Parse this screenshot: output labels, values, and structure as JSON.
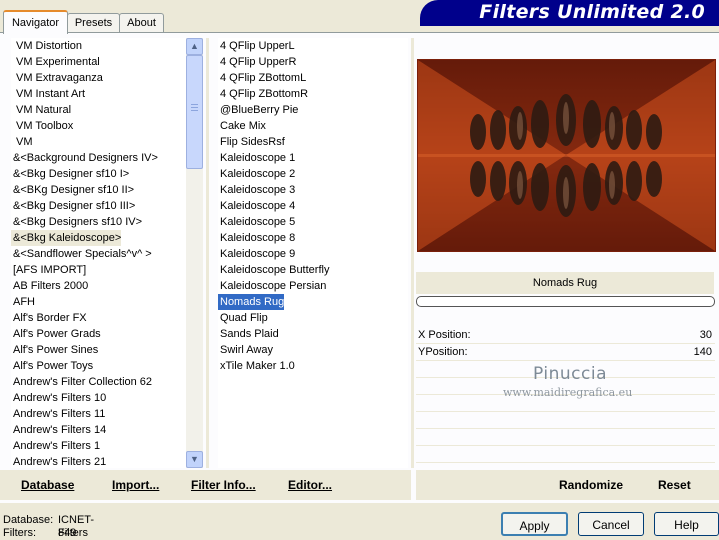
{
  "tabs": [
    "Navigator",
    "Presets",
    "About"
  ],
  "banner_title": "Filters Unlimited 2.0",
  "categories": [
    "VM Distortion",
    "VM Experimental",
    "VM Extravaganza",
    "VM Instant Art",
    "VM Natural",
    "VM Toolbox",
    "VM",
    "&<Background Designers IV>",
    "&<Bkg Designer sf10 I>",
    "&<BKg Designer sf10 II>",
    "&<Bkg Designer sf10 III>",
    "&<Bkg Designers sf10 IV>",
    "&<Bkg Kaleidoscope>",
    "&<Sandflower Specials^v^ >",
    "[AFS IMPORT]",
    "AB Filters 2000",
    "AFH",
    "Alf's Border FX",
    "Alf's Power Grads",
    "Alf's Power Sines",
    "Alf's Power Toys",
    "Andrew's Filter Collection 62",
    "Andrew's Filters 10",
    "Andrew's Filters 11",
    "Andrew's Filters 14",
    "Andrew's Filters 1",
    "Andrew's Filters 21"
  ],
  "filters": [
    "4 QFlip UpperL",
    "4 QFlip UpperR",
    "4 QFlip ZBottomL",
    "4 QFlip ZBottomR",
    "@BlueBerry Pie",
    "Cake Mix",
    "Flip SidesRsf",
    "Kaleidoscope 1",
    "Kaleidoscope 2",
    "Kaleidoscope 3",
    "Kaleidoscope 4",
    "Kaleidoscope 5",
    "Kaleidoscope 8",
    "Kaleidoscope 9",
    "Kaleidoscope Butterfly",
    "Kaleidoscope Persian",
    "Nomads Rug",
    "Quad Flip",
    "Sands Plaid",
    "Swirl Away",
    "xTile Maker 1.0"
  ],
  "bottom_links": {
    "database": "Database",
    "import": "Import...",
    "filter_info": "Filter Info...",
    "editor": "Editor...",
    "randomize": "Randomize",
    "reset": "Reset"
  },
  "selected_filter_name": "Nomads Rug",
  "params": [
    {
      "label": "X Position:",
      "value": "30"
    },
    {
      "label": "YPosition:",
      "value": "140"
    }
  ],
  "watermark": {
    "name": "Pinuccia",
    "site": "www.maidiregrafica.eu"
  },
  "status": {
    "database_label": "Database:",
    "database_value": "ICNET-Filters",
    "filters_label": "Filters:",
    "filters_value": "849"
  },
  "buttons": {
    "apply": "Apply",
    "cancel": "Cancel",
    "help": "Help"
  },
  "colors": {
    "selection": "#316ac5",
    "banner": "#00008b",
    "preview_base": "#8a2a10"
  }
}
